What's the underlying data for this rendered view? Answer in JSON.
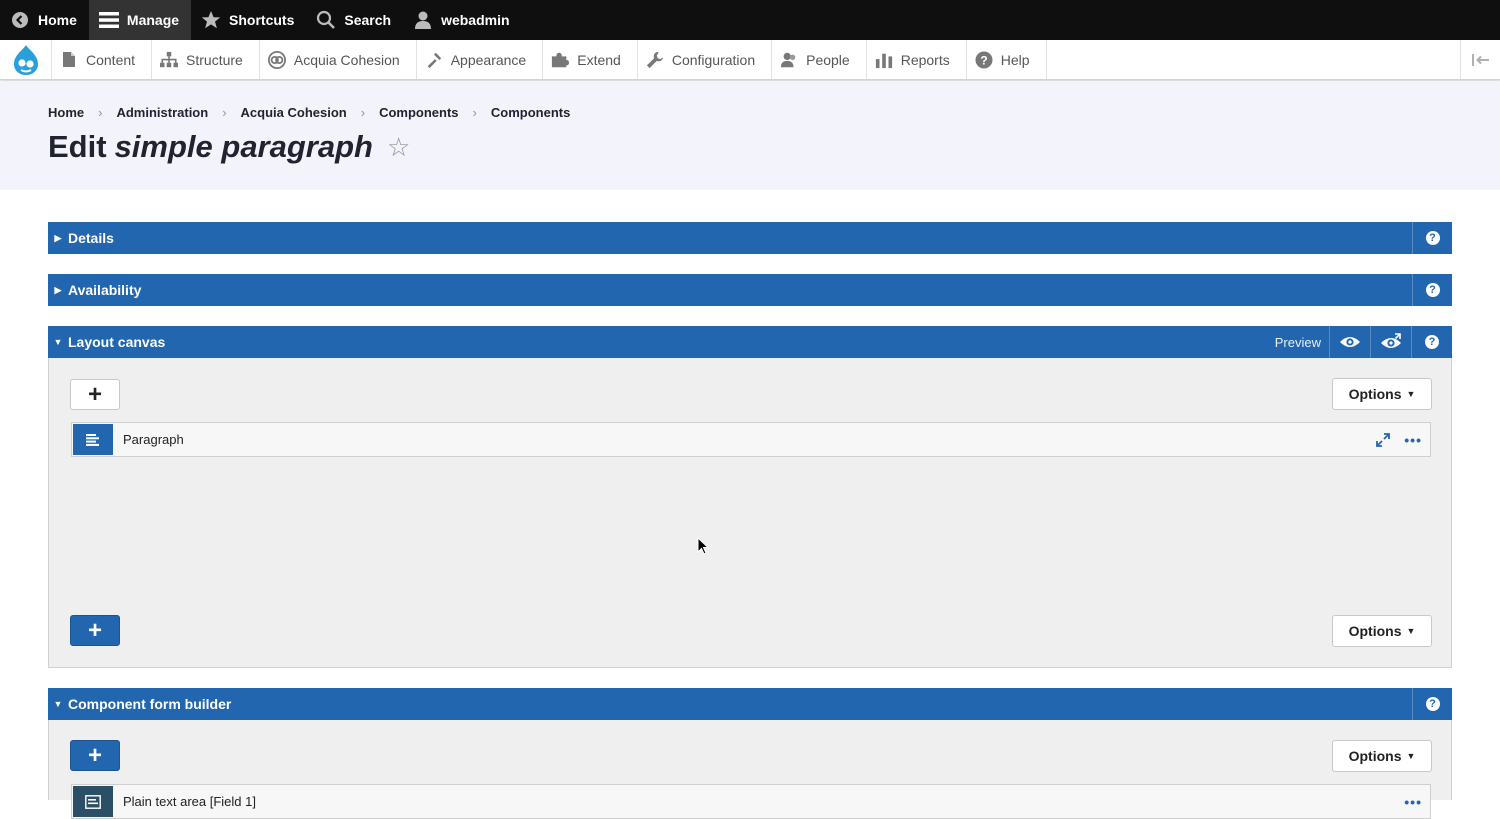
{
  "toolbar": {
    "home": "Home",
    "manage": "Manage",
    "shortcuts": "Shortcuts",
    "search": "Search",
    "user": "webadmin"
  },
  "tray": {
    "items": [
      "Content",
      "Structure",
      "Acquia Cohesion",
      "Appearance",
      "Extend",
      "Configuration",
      "People",
      "Reports",
      "Help"
    ]
  },
  "breadcrumb": [
    "Home",
    "Administration",
    "Acquia Cohesion",
    "Components",
    "Components"
  ],
  "page": {
    "title_prefix": "Edit",
    "title_name": "simple paragraph",
    "star": "☆"
  },
  "sections": {
    "details": "Details",
    "availability": "Availability",
    "layout_canvas": "Layout canvas",
    "component_form_builder": "Component form builder",
    "preview_label": "Preview",
    "help_glyph": "?"
  },
  "canvas": {
    "add_glyph": "+",
    "options_label": "Options",
    "items": [
      {
        "label": "Paragraph"
      }
    ]
  },
  "form_builder": {
    "add_glyph": "+",
    "options_label": "Options",
    "items": [
      {
        "label": "Plain text area [Field 1]"
      }
    ]
  },
  "colors": {
    "accent": "#2366b0",
    "toolbar_bg": "#0f0f0f",
    "header_bg": "#f3f4fb",
    "canvas_bg": "#efefef"
  },
  "icons": {
    "home": "chevron-left-circle-icon",
    "manage": "hamburger-icon",
    "shortcuts": "star-icon",
    "search": "magnifier-icon",
    "user": "person-icon"
  }
}
